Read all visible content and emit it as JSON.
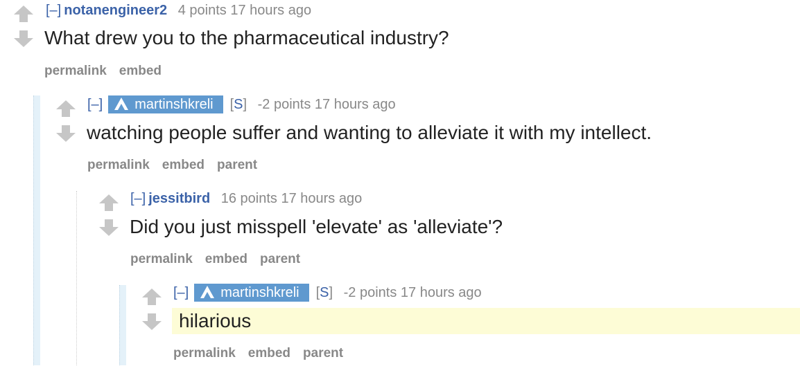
{
  "comments": [
    {
      "toggle": "[–]",
      "author": "notanengineer2",
      "score": "4 points 17 hours ago",
      "body": "What drew you to the pharmaceutical industry?",
      "buttons": [
        "permalink",
        "embed"
      ]
    },
    {
      "toggle": "[–]",
      "author": "martinshkreli",
      "op_open": "[",
      "op_letter": "S",
      "op_close": "]",
      "score": "-2 points 17 hours ago",
      "body": "watching people suffer and wanting to alleviate it with my intellect.",
      "buttons": [
        "permalink",
        "embed",
        "parent"
      ]
    },
    {
      "toggle": "[–]",
      "author": "jessitbird",
      "score": "16 points 17 hours ago",
      "body": "Did you just misspell 'elevate' as 'alleviate'?",
      "buttons": [
        "permalink",
        "embed",
        "parent"
      ]
    },
    {
      "toggle": "[–]",
      "author": "martinshkreli",
      "op_open": "[",
      "op_letter": "S",
      "op_close": "]",
      "score": "-2 points 17 hours ago",
      "body": "hilarious",
      "buttons": [
        "permalink",
        "embed",
        "parent"
      ]
    }
  ],
  "colors": {
    "author_link": "#3b62a8",
    "submitter_bg": "#5f99cf",
    "arrow": "#c6c6c6",
    "highlight_bg": "#fdfcd6"
  },
  "icons": [
    "upvote-arrow-icon",
    "downvote-arrow-icon",
    "submitter-icon"
  ]
}
